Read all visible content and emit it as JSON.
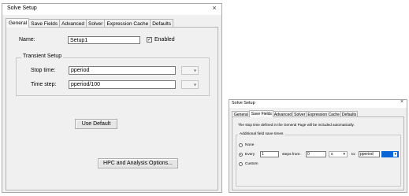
{
  "dialog1": {
    "title": "Solve Setup",
    "close": "×",
    "tabs": [
      "General",
      "Save Fields",
      "Advanced",
      "Solver",
      "Expression Cache",
      "Defaults"
    ],
    "name_label": "Name:",
    "name_value": "Setup1",
    "enabled_label": "Enabled",
    "enabled_check": "✓",
    "group_label": "Transient Setup",
    "stop_label": "Stop time:",
    "stop_value": "pperiod",
    "step_label": "Time step:",
    "step_value": "pperiod/100",
    "combo_arrow": "▾",
    "use_default": "Use Default",
    "hpc_button": "HPC and Analysis Options..."
  },
  "dialog2": {
    "title": "Solve Setup",
    "close": "×",
    "tabs": [
      "General",
      "Save Fields",
      "Advanced",
      "Solver",
      "Expression Cache",
      "Defaults"
    ],
    "info": "The stop time defined in the General Page will be included automatically.",
    "group_label": "Additional field save times",
    "none_label": "None",
    "every_label": "Every",
    "every_value": "1",
    "steps_from": "steps from:",
    "from_value": "0",
    "from_unit": "s",
    "to_label": "to:",
    "to_value": "pperiod",
    "to_unit": "",
    "custom_label": "Custom",
    "combo_arrow": "▾"
  }
}
